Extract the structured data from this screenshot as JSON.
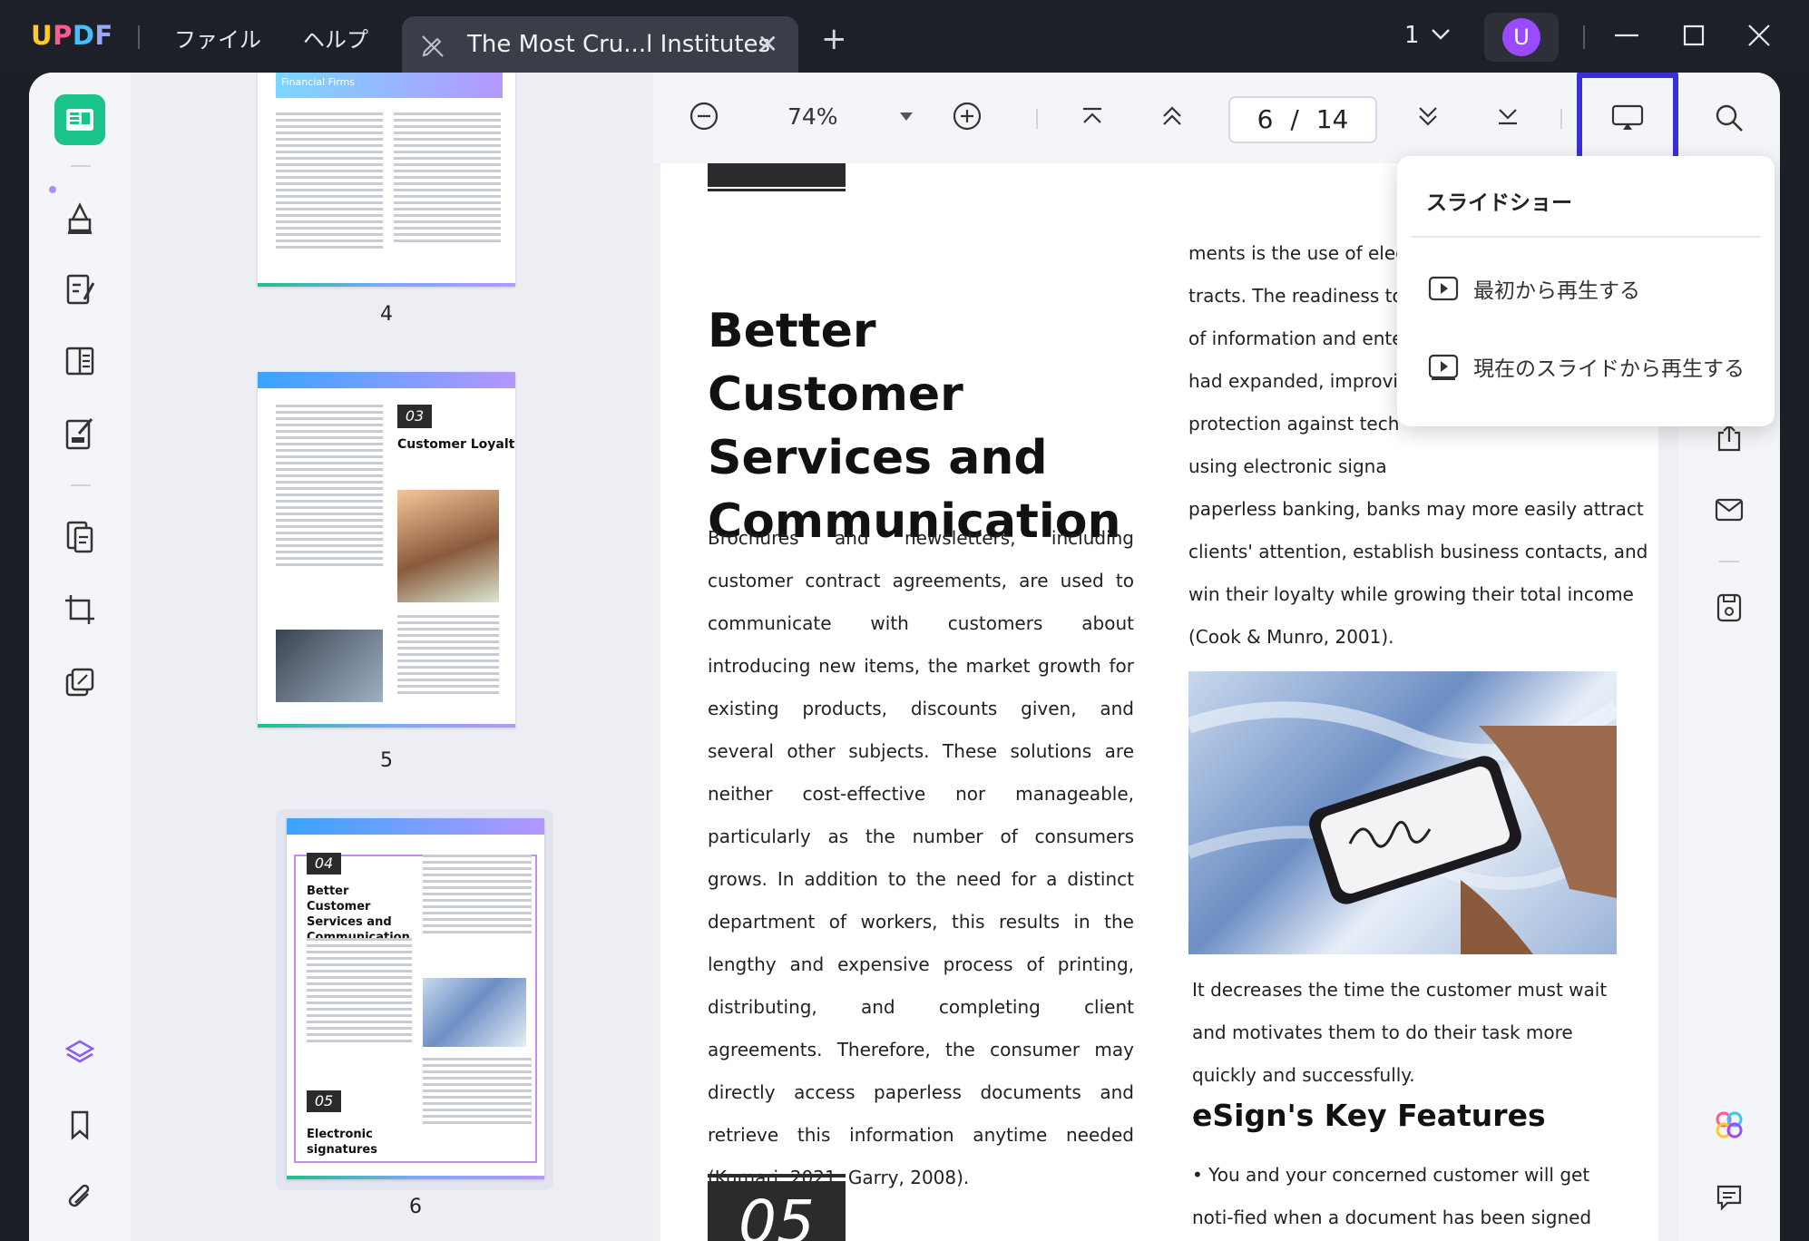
{
  "app": {
    "logo_text": {
      "u": "U",
      "p": "P",
      "d": "D",
      "f": "F"
    },
    "menu": {
      "file": "ファイル",
      "help": "ヘルプ"
    },
    "tab": {
      "title": "The Most Cru...l Institutes",
      "close": "✕"
    },
    "tab_add": "+",
    "window_count": "1",
    "avatar_letter": "U",
    "colors": {
      "accent_green": "#19c38a",
      "highlight_blue": "#3b2fd6",
      "avatar_purple": "#9b4bff"
    }
  },
  "toolbar": {
    "zoom": "74%",
    "page_current": "6",
    "page_sep": "/",
    "page_total": "14"
  },
  "thumbnails": {
    "items": [
      {
        "number": "4",
        "banner": "Financial Firms"
      },
      {
        "number": "5",
        "section_num": "03",
        "section_title": "Customer Loyalty"
      },
      {
        "number": "6",
        "section_num": "04",
        "section_title": "Better Customer Services and Communication",
        "section_num2": "05",
        "section_title2": "Electronic signatures"
      }
    ]
  },
  "document": {
    "heading": "Better Customer Services and Communication",
    "left_paragraph": "Brochures and newsletters, including customer contract agreements, are used to communicate with customers about introducing new items, the market growth for existing products, discounts given, and several other subjects. These solutions are neither cost-effective nor manageable, particularly as the number of consumers grows. In addition to the need for a distinct department of workers, this results in the lengthy and expensive process of printing, distributing, and completing client agreements. Therefore, the consumer may directly access paperless documents and retrieve this information anytime needed (Kumari, 2021; Garry, 2008).",
    "section_number": "05",
    "right_lines": [
      "ments is the use of elect",
      "tracts. The readiness to a",
      "of information and enter",
      "had expanded, improvi",
      "protection against tech",
      "using electronic signa",
      "paperless banking, banks may more easily attract",
      "clients' attention, establish business contacts, and",
      "win their loyalty while growing their total income",
      "(Cook & Munro, 2001)."
    ],
    "caption_paragraph": "It decreases the time the customer must wait and motivates them to do their task more quickly and successfully.",
    "subheading": "eSign's Key Features",
    "bullet": "• You and your concerned customer will get noti-fied when a document has been signed electroni-cally"
  },
  "slideshow_menu": {
    "title": "スライドショー",
    "items": [
      {
        "label": "最初から再生する"
      },
      {
        "label": "現在のスライドから再生する"
      }
    ]
  }
}
